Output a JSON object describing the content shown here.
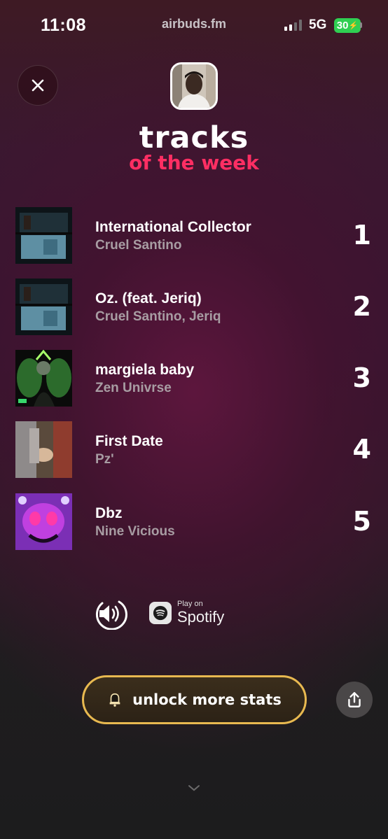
{
  "status_bar": {
    "time": "11:08",
    "url": "airbuds.fm",
    "network": "5G",
    "battery": "30"
  },
  "header": {
    "close_icon": "close-icon",
    "title": "tracks",
    "subtitle": "of the week",
    "accent_color": "#ff2e63"
  },
  "tracks": [
    {
      "name": "International Collector",
      "artist": "Cruel Santino",
      "rank": "1"
    },
    {
      "name": "Oz. (feat. Jeriq)",
      "artist": "Cruel Santino, Jeriq",
      "rank": "2"
    },
    {
      "name": "margiela baby",
      "artist": "Zen Univrse",
      "rank": "3"
    },
    {
      "name": "First Date",
      "artist": "Pz'",
      "rank": "4"
    },
    {
      "name": "Dbz",
      "artist": "Nine Vicious",
      "rank": "5"
    }
  ],
  "controls": {
    "volume_icon": "speaker-icon",
    "spotify_play_on": "Play on",
    "spotify_name": "Spotify"
  },
  "footer": {
    "unlock_label": "unlock more stats",
    "unlock_icon": "bell-icon",
    "share_icon": "share-icon",
    "chevron_icon": "chevron-down-icon",
    "gold_color": "#e8b950"
  }
}
